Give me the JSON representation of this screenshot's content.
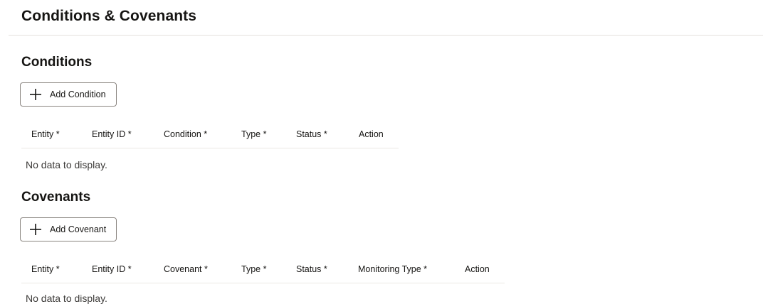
{
  "page": {
    "title": "Conditions & Covenants"
  },
  "conditions": {
    "title": "Conditions",
    "add_button_label": "Add Condition",
    "columns": [
      "Entity *",
      "Entity ID *",
      "Condition *",
      "Type *",
      "Status *",
      "Action"
    ],
    "empty_text": "No data to display."
  },
  "covenants": {
    "title": "Covenants",
    "add_button_label": "Add Covenant",
    "columns": [
      "Entity *",
      "Entity ID *",
      "Covenant *",
      "Type *",
      "Status *",
      "Monitoring Type *",
      "Action"
    ],
    "empty_text": "No data to display."
  },
  "icons": {
    "add": "plus-icon"
  },
  "colors": {
    "text": "#161513",
    "border": "#8a8580",
    "divider": "#e4e1dd"
  }
}
